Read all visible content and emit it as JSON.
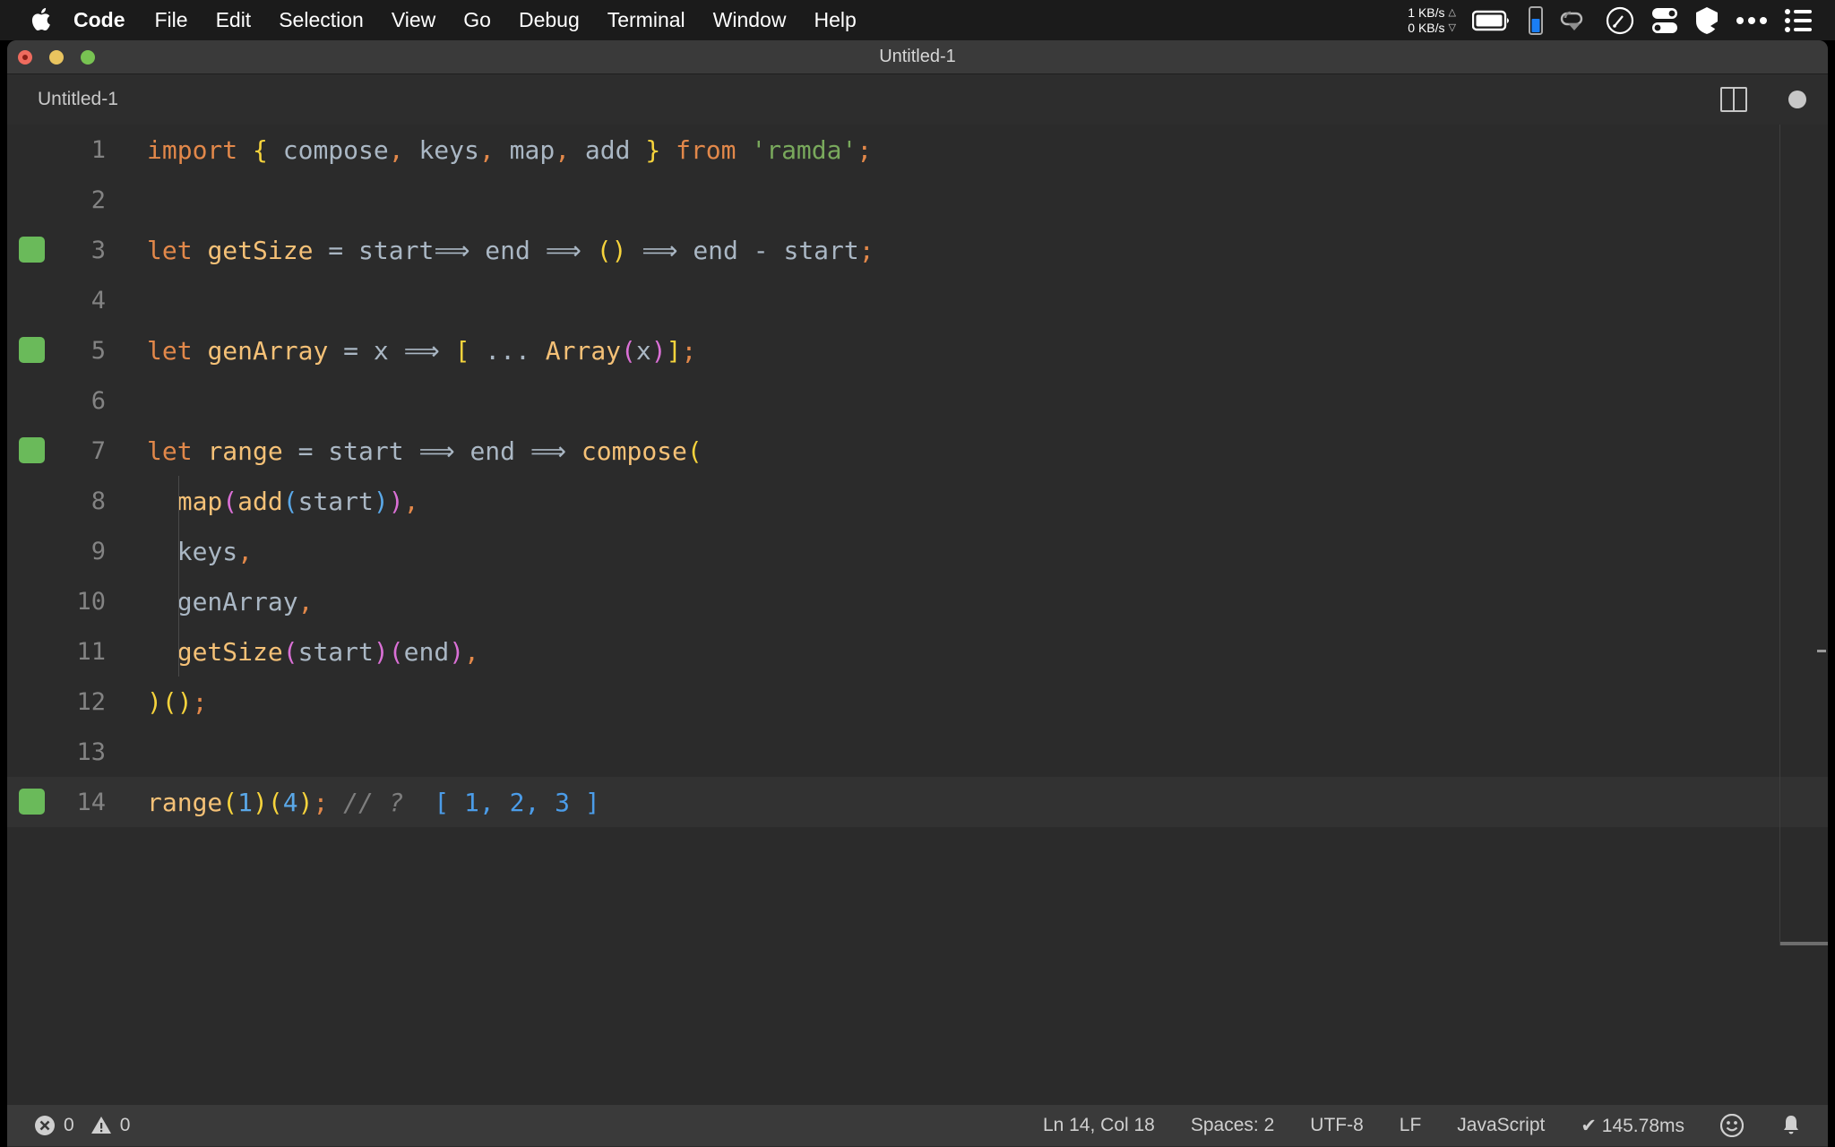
{
  "menubar": {
    "apple_icon": "apple-logo-icon",
    "items": [
      {
        "label": "Code",
        "bold": true
      },
      {
        "label": "File",
        "bold": false
      },
      {
        "label": "Edit",
        "bold": false
      },
      {
        "label": "Selection",
        "bold": false
      },
      {
        "label": "View",
        "bold": false
      },
      {
        "label": "Go",
        "bold": false
      },
      {
        "label": "Debug",
        "bold": false
      },
      {
        "label": "Terminal",
        "bold": false
      },
      {
        "label": "Window",
        "bold": false
      },
      {
        "label": "Help",
        "bold": false
      }
    ],
    "network": {
      "upload": "1 KB/s",
      "download": "0 KB/s",
      "up_arrow": "△",
      "down_arrow": "▽"
    },
    "tray_icons": [
      "battery-icon",
      "battery-meter-icon",
      "cloud-sync-icon",
      "speedometer-icon",
      "toggles-icon",
      "shield-icon",
      "ellipsis-icon",
      "control-center-icon"
    ]
  },
  "window": {
    "title": "Untitled-1",
    "traffic_lights": [
      "close-button",
      "minimize-button",
      "zoom-button"
    ]
  },
  "tabbar": {
    "active_tab": "Untitled-1",
    "split_editor_label": "split-editor",
    "more_actions_label": "more-actions"
  },
  "editor": {
    "lines": [
      {
        "number": "1",
        "marked": false,
        "indent_guide": false,
        "tokens": [
          {
            "text": "import",
            "cls": "t-kw"
          },
          {
            "text": " ",
            "cls": "t-plain"
          },
          {
            "text": "{",
            "cls": "t-b1"
          },
          {
            "text": " compose",
            "cls": "t-plain"
          },
          {
            "text": ",",
            "cls": "t-punct"
          },
          {
            "text": " keys",
            "cls": "t-plain"
          },
          {
            "text": ",",
            "cls": "t-punct"
          },
          {
            "text": " map",
            "cls": "t-plain"
          },
          {
            "text": ",",
            "cls": "t-punct"
          },
          {
            "text": " add ",
            "cls": "t-plain"
          },
          {
            "text": "}",
            "cls": "t-b1"
          },
          {
            "text": " ",
            "cls": "t-plain"
          },
          {
            "text": "from",
            "cls": "t-kw"
          },
          {
            "text": " ",
            "cls": "t-plain"
          },
          {
            "text": "'ramda'",
            "cls": "t-str"
          },
          {
            "text": ";",
            "cls": "t-punct"
          }
        ]
      },
      {
        "number": "2",
        "marked": false,
        "indent_guide": false,
        "tokens": []
      },
      {
        "number": "3",
        "marked": true,
        "indent_guide": false,
        "tokens": [
          {
            "text": "let",
            "cls": "t-kw"
          },
          {
            "text": " ",
            "cls": "t-plain"
          },
          {
            "text": "getSize",
            "cls": "t-fn"
          },
          {
            "text": " = start",
            "cls": "t-plain"
          },
          {
            "text": "⟹",
            "cls": "t-op"
          },
          {
            "text": " end ",
            "cls": "t-plain"
          },
          {
            "text": "⟹",
            "cls": "t-op"
          },
          {
            "text": " ",
            "cls": "t-plain"
          },
          {
            "text": "()",
            "cls": "t-b1"
          },
          {
            "text": " ",
            "cls": "t-plain"
          },
          {
            "text": "⟹",
            "cls": "t-op"
          },
          {
            "text": " end - start",
            "cls": "t-plain"
          },
          {
            "text": ";",
            "cls": "t-punct"
          }
        ]
      },
      {
        "number": "4",
        "marked": false,
        "indent_guide": false,
        "tokens": []
      },
      {
        "number": "5",
        "marked": true,
        "indent_guide": false,
        "tokens": [
          {
            "text": "let",
            "cls": "t-kw"
          },
          {
            "text": " ",
            "cls": "t-plain"
          },
          {
            "text": "genArray",
            "cls": "t-fn"
          },
          {
            "text": " = x ",
            "cls": "t-plain"
          },
          {
            "text": "⟹",
            "cls": "t-op"
          },
          {
            "text": " ",
            "cls": "t-plain"
          },
          {
            "text": "[",
            "cls": "t-b1"
          },
          {
            "text": " ... ",
            "cls": "t-plain"
          },
          {
            "text": "Array",
            "cls": "t-fn"
          },
          {
            "text": "(",
            "cls": "t-b2"
          },
          {
            "text": "x",
            "cls": "t-plain"
          },
          {
            "text": ")",
            "cls": "t-b2"
          },
          {
            "text": "]",
            "cls": "t-b1"
          },
          {
            "text": ";",
            "cls": "t-punct"
          }
        ]
      },
      {
        "number": "6",
        "marked": false,
        "indent_guide": false,
        "tokens": []
      },
      {
        "number": "7",
        "marked": true,
        "indent_guide": false,
        "tokens": [
          {
            "text": "let",
            "cls": "t-kw"
          },
          {
            "text": " ",
            "cls": "t-plain"
          },
          {
            "text": "range",
            "cls": "t-fn"
          },
          {
            "text": " = start ",
            "cls": "t-plain"
          },
          {
            "text": "⟹",
            "cls": "t-op"
          },
          {
            "text": " end ",
            "cls": "t-plain"
          },
          {
            "text": "⟹",
            "cls": "t-op"
          },
          {
            "text": " ",
            "cls": "t-plain"
          },
          {
            "text": "compose",
            "cls": "t-fn"
          },
          {
            "text": "(",
            "cls": "t-b1"
          }
        ]
      },
      {
        "number": "8",
        "marked": false,
        "indent_guide": true,
        "tokens": [
          {
            "text": "  ",
            "cls": "t-plain"
          },
          {
            "text": "map",
            "cls": "t-fn"
          },
          {
            "text": "(",
            "cls": "t-b2"
          },
          {
            "text": "add",
            "cls": "t-fn"
          },
          {
            "text": "(",
            "cls": "t-b3"
          },
          {
            "text": "start",
            "cls": "t-plain"
          },
          {
            "text": ")",
            "cls": "t-b3"
          },
          {
            "text": ")",
            "cls": "t-b2"
          },
          {
            "text": ",",
            "cls": "t-punct"
          }
        ]
      },
      {
        "number": "9",
        "marked": false,
        "indent_guide": true,
        "tokens": [
          {
            "text": "  keys",
            "cls": "t-plain"
          },
          {
            "text": ",",
            "cls": "t-punct"
          }
        ]
      },
      {
        "number": "10",
        "marked": false,
        "indent_guide": true,
        "tokens": [
          {
            "text": "  genArray",
            "cls": "t-plain"
          },
          {
            "text": ",",
            "cls": "t-punct"
          }
        ]
      },
      {
        "number": "11",
        "marked": false,
        "indent_guide": true,
        "tokens": [
          {
            "text": "  ",
            "cls": "t-plain"
          },
          {
            "text": "getSize",
            "cls": "t-fn"
          },
          {
            "text": "(",
            "cls": "t-b2"
          },
          {
            "text": "start",
            "cls": "t-plain"
          },
          {
            "text": ")",
            "cls": "t-b2"
          },
          {
            "text": "(",
            "cls": "t-b2"
          },
          {
            "text": "end",
            "cls": "t-plain"
          },
          {
            "text": ")",
            "cls": "t-b2"
          },
          {
            "text": ",",
            "cls": "t-punct"
          }
        ]
      },
      {
        "number": "12",
        "marked": false,
        "indent_guide": false,
        "tokens": [
          {
            "text": ")()",
            "cls": "t-b1"
          },
          {
            "text": ";",
            "cls": "t-punct"
          }
        ]
      },
      {
        "number": "13",
        "marked": false,
        "indent_guide": false,
        "tokens": []
      },
      {
        "number": "14",
        "marked": true,
        "current": true,
        "indent_guide": false,
        "tokens": [
          {
            "text": "range",
            "cls": "t-fn"
          },
          {
            "text": "(",
            "cls": "t-b1"
          },
          {
            "text": "1",
            "cls": "t-num"
          },
          {
            "text": ")",
            "cls": "t-b1"
          },
          {
            "text": "(",
            "cls": "t-b1"
          },
          {
            "text": "4",
            "cls": "t-num"
          },
          {
            "text": ")",
            "cls": "t-b1"
          },
          {
            "text": ";",
            "cls": "t-punct"
          },
          {
            "text": " // ?",
            "cls": "t-comment"
          },
          {
            "text": "  [ 1, 2, 3 ]",
            "cls": "t-result"
          }
        ]
      }
    ]
  },
  "statusbar": {
    "errors": "0",
    "warnings": "0",
    "cursor": "Ln 14, Col 18",
    "indentation": "Spaces: 2",
    "encoding": "UTF-8",
    "eol": "LF",
    "language": "JavaScript",
    "runtime": "✔ 145.78ms",
    "feedback_icon": "smiley-icon",
    "notifications_icon": "bell-icon"
  },
  "colors": {
    "accent_green": "#6aba5a",
    "keyword": "#e2884a",
    "function": "#f5c177",
    "string": "#79a95c",
    "number": "#5aa8e8",
    "bracket1": "#f6d33c",
    "bracket2": "#da70d6",
    "bracket3": "#5aa8e8",
    "editor_bg": "#2b2b2b",
    "statusbar_bg": "#3a3a3a"
  }
}
